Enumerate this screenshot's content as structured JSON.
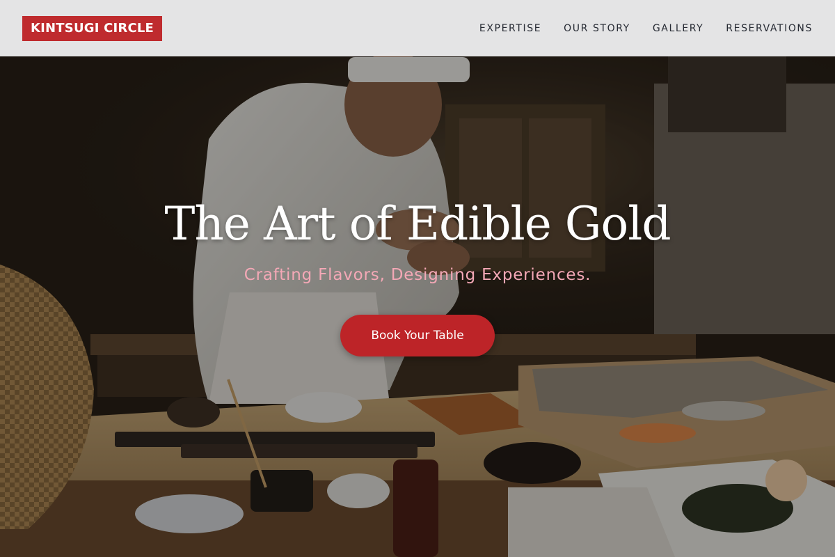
{
  "brand": {
    "name": "KINTSUGI CIRCLE",
    "accent_color": "#bf2b2e"
  },
  "nav": {
    "items": [
      {
        "label": "EXPERTISE"
      },
      {
        "label": "OUR STORY"
      },
      {
        "label": "GALLERY"
      },
      {
        "label": "RESERVATIONS"
      }
    ]
  },
  "hero": {
    "title": "The Art of Edible Gold",
    "subtitle": "Crafting Flavors, Designing Experiences.",
    "cta_label": "Book Your Table",
    "subtitle_color": "#f4a8b6",
    "cta_color": "#bd2428",
    "background_image": "chef-preparing-sushi-photo"
  }
}
